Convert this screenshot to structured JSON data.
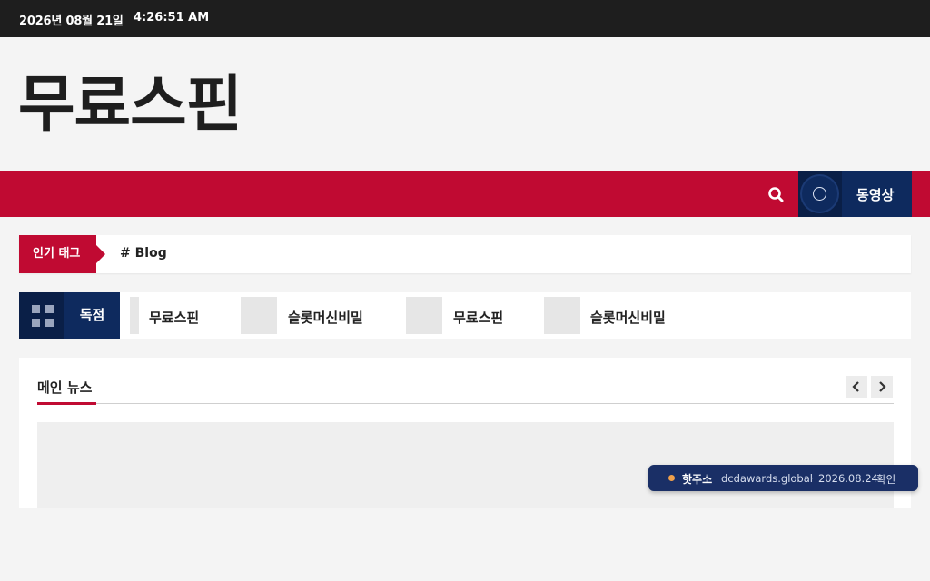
{
  "topbar": {
    "date": "2026년 08월 21일",
    "time": "4:26:51 AM"
  },
  "site": {
    "title": "무료스핀"
  },
  "navbar": {
    "search_icon": "search-icon",
    "video_icon": "circle-icon",
    "video_label": "동영상",
    "color_bg": "#c00a32",
    "color_video": "#0e2a5e"
  },
  "tags": {
    "label": "인기 태그",
    "items": [
      "# Blog"
    ]
  },
  "exclusive": {
    "icon": "grid-icon",
    "label": "독점",
    "items": [
      {
        "label": "무료스핀"
      },
      {
        "label": "슬롯머신비밀"
      },
      {
        "label": "무료스핀"
      },
      {
        "label": "슬롯머신비밀"
      }
    ]
  },
  "main_news": {
    "title": "메인 뉴스",
    "prev_icon": "chevron-left-icon",
    "next_icon": "chevron-right-icon"
  },
  "toast": {
    "label": "핫주소",
    "domain": "dcdawards.global",
    "separator": "·",
    "date": "2026.08.24",
    "action": "확인",
    "dot_color": "#f0a04b"
  }
}
